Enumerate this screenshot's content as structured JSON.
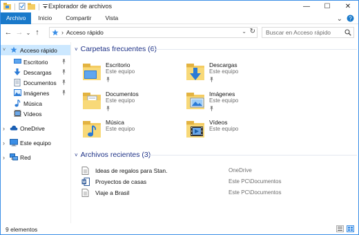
{
  "window": {
    "title": "Explorador de archivos",
    "controls": {
      "minimize": "—",
      "maximize": "☐",
      "close": "✕"
    }
  },
  "ribbon": {
    "tabs": [
      "Archivo",
      "Inicio",
      "Compartir",
      "Vista"
    ],
    "expand_glyph": "⌄",
    "help_glyph": "?"
  },
  "nav_glyphs": {
    "back": "←",
    "forward": "→",
    "recent": "⌄",
    "up": "↑",
    "address_dropdown": "⌄",
    "refresh": "↻"
  },
  "address": {
    "path": "Acceso rápido",
    "separator": "›"
  },
  "search": {
    "placeholder": "Buscar en Acceso rápido"
  },
  "sidebar": {
    "items": [
      {
        "label": "Acceso rápido",
        "icon": "star-icon",
        "selected": true,
        "expander": "˅"
      },
      {
        "label": "Escritorio",
        "icon": "desktop-icon",
        "pinned": true
      },
      {
        "label": "Descargas",
        "icon": "download-icon",
        "pinned": true
      },
      {
        "label": "Documentos",
        "icon": "documents-icon",
        "pinned": true
      },
      {
        "label": "Imágenes",
        "icon": "pictures-icon",
        "pinned": true
      },
      {
        "label": "Música",
        "icon": "music-icon"
      },
      {
        "label": "Vídeos",
        "icon": "videos-icon"
      },
      {
        "label": "OneDrive",
        "icon": "cloud-icon",
        "expander": "›"
      },
      {
        "label": "Este equipo",
        "icon": "computer-icon",
        "expander": "›"
      },
      {
        "label": "Red",
        "icon": "network-icon",
        "expander": "›"
      }
    ]
  },
  "frequent": {
    "heading": "Carpetas frecuentes (6)",
    "chevron": "˅",
    "folders": [
      {
        "name": "Escritorio",
        "location": "Este equipo",
        "pinned": true,
        "icon": "desktop-folder-icon"
      },
      {
        "name": "Descargas",
        "location": "Este equipo",
        "pinned": true,
        "icon": "downloads-folder-icon"
      },
      {
        "name": "Documentos",
        "location": "Este equipo",
        "pinned": true,
        "icon": "documents-folder-icon"
      },
      {
        "name": "Imágenes",
        "location": "Este equipo",
        "pinned": true,
        "icon": "pictures-folder-icon"
      },
      {
        "name": "Música",
        "location": "Este equipo",
        "pinned": false,
        "icon": "music-folder-icon"
      },
      {
        "name": "Vídeos",
        "location": "Este equipo",
        "pinned": false,
        "icon": "videos-folder-icon"
      }
    ]
  },
  "recent": {
    "heading": "Archivos recientes (3)",
    "chevron": "˅",
    "files": [
      {
        "name": "Ideas de regalos para Stan.",
        "location": "OneDrive",
        "icon": "text-file-icon"
      },
      {
        "name": "Proyectos de casas",
        "location": "Este PC\\Documentos",
        "icon": "word-file-icon"
      },
      {
        "name": "Viaje a Brasil",
        "location": "Este PC\\Documentos",
        "icon": "text-file-icon"
      }
    ]
  },
  "status": {
    "items_count": "9 elementos"
  },
  "colors": {
    "accent": "#1979ca",
    "selected": "#cce8ff",
    "heading": "#1e3287",
    "folder": "#f4cc62"
  }
}
